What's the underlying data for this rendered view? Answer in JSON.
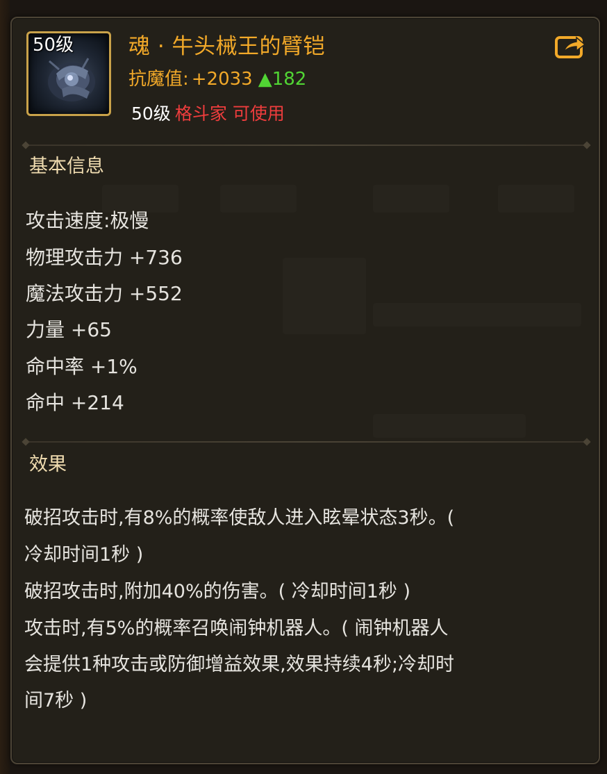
{
  "item": {
    "level_badge": "50级",
    "name": "魂 · 牛头械王的臂铠",
    "icon": "armguard-item-icon",
    "anti_magic_label": "抗魔值:",
    "anti_magic_value": "+2033",
    "anti_magic_diff": "▲182",
    "required_level": "50级",
    "required_class": "格斗家",
    "usable_text": "可使用",
    "share_icon": "share-export-icon"
  },
  "basic_info": {
    "title": "基本信息",
    "stats": [
      "攻击速度:极慢",
      "物理攻击力 +736",
      "魔法攻击力 +552",
      "力量 +65",
      "命中率 +1%",
      "命中 +214"
    ]
  },
  "effects": {
    "title": "效果",
    "lines": [
      "破招攻击时,有8%的概率使敌人进入眩晕状态3秒。(",
      "冷却时间1秒 )",
      "破招攻击时,附加40%的伤害。( 冷却时间1秒 )",
      "攻击时,有5%的概率召唤闹钟机器人。( 闹钟机器人",
      "会提供1种攻击或防御增益效果,效果持续4秒;冷却时",
      "间7秒 )"
    ]
  },
  "colors": {
    "item_name": "#f2a929",
    "anti_magic": "#f2a929",
    "increase": "#51d534",
    "class_requirement": "#ef3d3d",
    "section_title": "#f0dcb0",
    "body_text": "#e6e4df",
    "panel_bg": "#232019",
    "icon_frame": "#c9a24a"
  }
}
